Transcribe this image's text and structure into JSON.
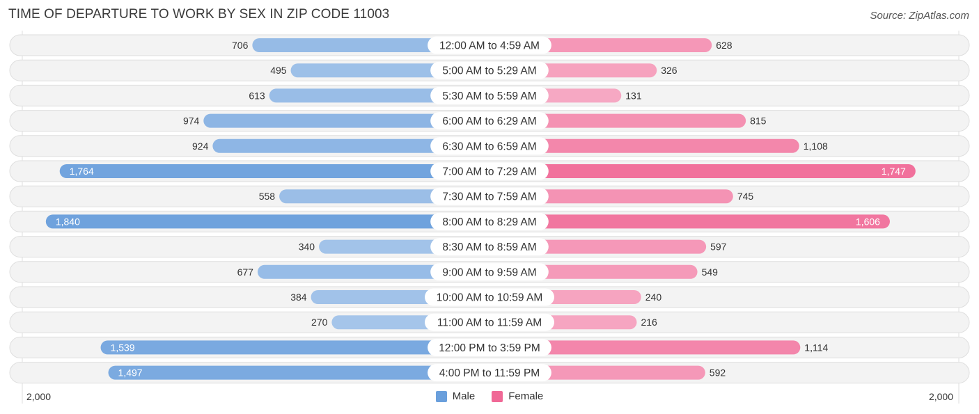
{
  "header": {
    "title": "TIME OF DEPARTURE TO WORK BY SEX IN ZIP CODE 11003",
    "source": "Source: ZipAtlas.com"
  },
  "chart_data": {
    "type": "bar",
    "orientation": "horizontal-diverging",
    "title": "TIME OF DEPARTURE TO WORK BY SEX IN ZIP CODE 11003",
    "categories": [
      "12:00 AM to 4:59 AM",
      "5:00 AM to 5:29 AM",
      "5:30 AM to 5:59 AM",
      "6:00 AM to 6:29 AM",
      "6:30 AM to 6:59 AM",
      "7:00 AM to 7:29 AM",
      "7:30 AM to 7:59 AM",
      "8:00 AM to 8:29 AM",
      "8:30 AM to 8:59 AM",
      "9:00 AM to 9:59 AM",
      "10:00 AM to 10:59 AM",
      "11:00 AM to 11:59 AM",
      "12:00 PM to 3:59 PM",
      "4:00 PM to 11:59 PM"
    ],
    "series": [
      {
        "name": "Male",
        "color": "#6a9fdc",
        "values": [
          706,
          495,
          613,
          974,
          924,
          1764,
          558,
          1840,
          340,
          677,
          384,
          270,
          1539,
          1497
        ]
      },
      {
        "name": "Female",
        "color": "#f06896",
        "values": [
          628,
          326,
          131,
          815,
          1108,
          1747,
          745,
          1606,
          597,
          549,
          240,
          216,
          1114,
          592
        ]
      }
    ],
    "value_labels": {
      "Male": [
        "706",
        "495",
        "613",
        "974",
        "924",
        "1,764",
        "558",
        "1,840",
        "340",
        "677",
        "384",
        "270",
        "1,539",
        "1,497"
      ],
      "Female": [
        "628",
        "326",
        "131",
        "815",
        "1,108",
        "1,747",
        "745",
        "1,606",
        "597",
        "549",
        "240",
        "216",
        "1,114",
        "592"
      ]
    },
    "xlim": [
      0,
      2000
    ],
    "axis_tick_labels": {
      "left": "2,000",
      "right": "2,000"
    },
    "legend": {
      "position": "bottom-center",
      "entries": [
        "Male",
        "Female"
      ]
    },
    "grid": false
  }
}
